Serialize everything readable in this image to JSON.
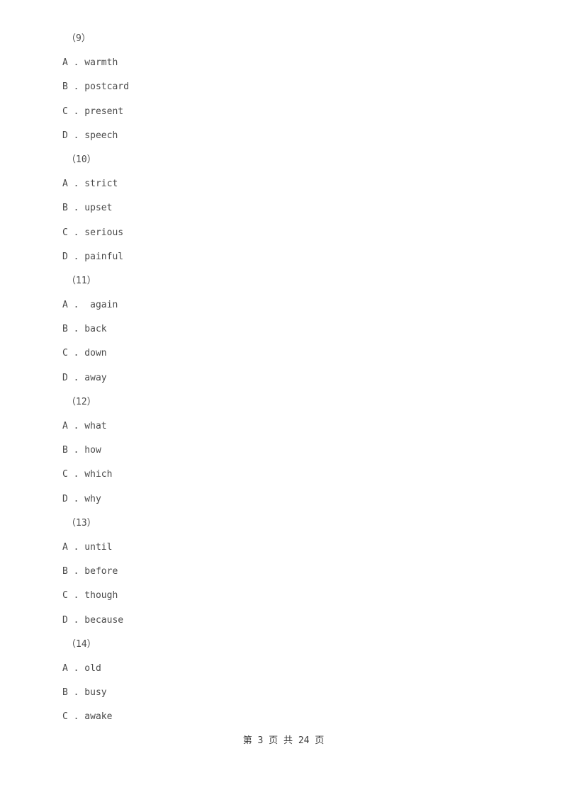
{
  "document": {
    "blocks": [
      {
        "label": "（9）",
        "options": [
          "A . warmth",
          "B . postcard",
          "C . present",
          "D . speech"
        ]
      },
      {
        "label": "（10）",
        "options": [
          "A . strict",
          "B . upset",
          "C . serious",
          "D . painful"
        ]
      },
      {
        "label": "（11）",
        "options": [
          "A .  again",
          "B . back",
          "C . down",
          "D . away"
        ]
      },
      {
        "label": "（12）",
        "options": [
          "A . what",
          "B . how",
          "C . which",
          "D . why"
        ]
      },
      {
        "label": "（13）",
        "options": [
          "A . until",
          "B . before",
          "C . though",
          "D . because"
        ]
      },
      {
        "label": "（14）",
        "options": [
          "A . old",
          "B . busy",
          "C . awake"
        ]
      }
    ],
    "footer": "第 3 页 共 24 页"
  }
}
